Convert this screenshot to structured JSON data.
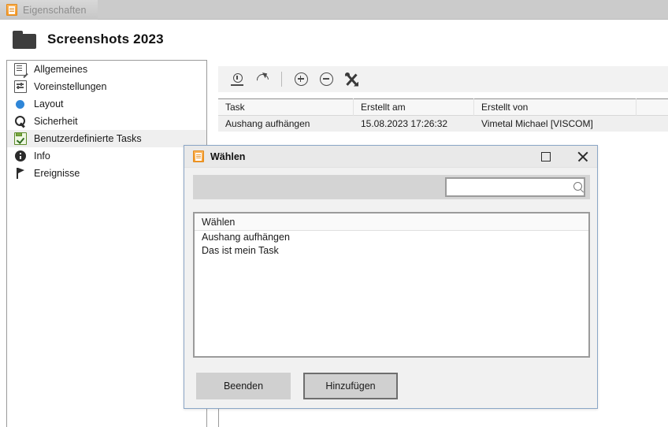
{
  "tabbar": {
    "tabs": [
      {
        "label": "Eigenschaften",
        "icon": "document-icon"
      }
    ]
  },
  "header": {
    "title": "Screenshots 2023",
    "icon": "folder-icon"
  },
  "sidebar": {
    "items": [
      {
        "label": "Allgemeines",
        "icon": "general-list-icon",
        "selected": false
      },
      {
        "label": "Voreinstellungen",
        "icon": "sliders-icon",
        "selected": false
      },
      {
        "label": "Layout",
        "icon": "blue-dot-icon",
        "selected": false
      },
      {
        "label": "Sicherheit",
        "icon": "key-icon",
        "selected": false
      },
      {
        "label": "Benutzerdefinierte Tasks",
        "icon": "clipboard-check-icon",
        "selected": true
      },
      {
        "label": "Info",
        "icon": "info-icon",
        "selected": false
      },
      {
        "label": "Ereignisse",
        "icon": "flag-icon",
        "selected": false
      }
    ]
  },
  "toolbar": {
    "buttons": [
      {
        "name": "export-button",
        "icon": "export-icon"
      },
      {
        "name": "refresh-button",
        "icon": "refresh-icon"
      },
      {
        "name": "add-button",
        "icon": "plus-circle-icon"
      },
      {
        "name": "remove-button",
        "icon": "minus-circle-icon"
      },
      {
        "name": "tools-button",
        "icon": "tools-icon"
      }
    ]
  },
  "table": {
    "columns": [
      "Task",
      "Erstellt am",
      "Erstellt von",
      ""
    ],
    "rows": [
      {
        "task": "Aushang aufhängen",
        "created_at": "15.08.2023 17:26:32",
        "created_by": "Vimetal Michael [VISCOM]",
        "extra": ""
      }
    ]
  },
  "dialog": {
    "title": "Wählen",
    "title_icon": "document-icon",
    "maximize_label": "",
    "close_label": "",
    "search": {
      "value": "",
      "placeholder": "",
      "icon": "search-icon"
    },
    "list": {
      "header": "Wählen",
      "items": [
        "Aushang aufhängen",
        "Das ist mein Task"
      ]
    },
    "buttons": {
      "cancel": "Beenden",
      "confirm": "Hinzufügen"
    }
  },
  "colors": {
    "tabbar_bg": "#cbcbcb",
    "dialog_border": "#8ba6c6",
    "selection_bg": "#efefef",
    "accent_orange": "#f79a26",
    "layout_blue": "#2f86d8"
  }
}
